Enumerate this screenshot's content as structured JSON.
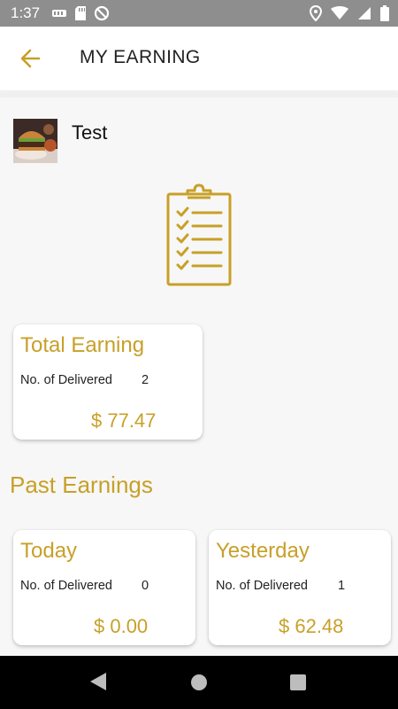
{
  "status_bar": {
    "time": "1:37",
    "left_icons": [
      "app-notification-icon",
      "sd-card-icon",
      "sync-off-icon"
    ],
    "right_icons": [
      "location-icon",
      "wifi-icon",
      "signal-icon",
      "battery-icon"
    ]
  },
  "app_bar": {
    "back_icon": "arrow-left-icon",
    "title": "MY EARNING"
  },
  "profile": {
    "name": "Test"
  },
  "total_card": {
    "title": "Total Earning",
    "delivered_label": "No. of Delivered",
    "delivered_count": "2",
    "amount": "$ 77.47"
  },
  "past_earnings": {
    "title": "Past Earnings",
    "cards": [
      {
        "title": "Today",
        "delivered_label": "No. of Delivered",
        "delivered_count": "0",
        "amount": "$ 0.00"
      },
      {
        "title": "Yesterday",
        "delivered_label": "No. of Delivered",
        "delivered_count": "1",
        "amount": "$ 62.48"
      }
    ]
  },
  "nav_bar": {
    "buttons": [
      "back-triangle-icon",
      "home-circle-icon",
      "recents-square-icon"
    ]
  },
  "colors": {
    "accent": "#c8a028",
    "status_bar": "#8e8e8e",
    "background": "#f7f7f7"
  }
}
